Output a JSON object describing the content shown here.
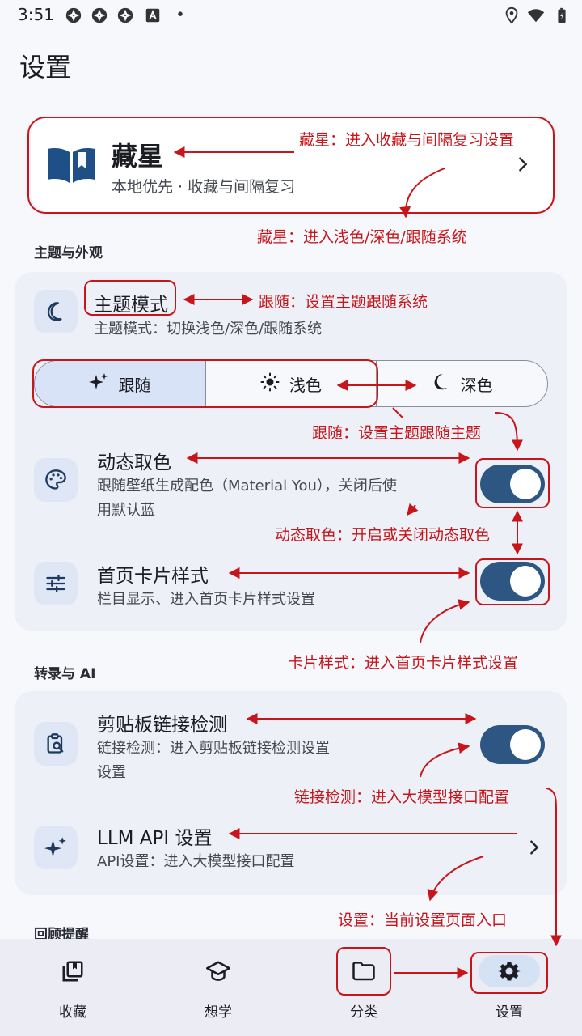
{
  "status_bar": {
    "time": "3:51",
    "icons": [
      "aperture-icon",
      "aperture-icon",
      "aperture-icon",
      "font-a-icon",
      "dot-icon",
      "location-icon",
      "wifi-icon",
      "battery-icon"
    ]
  },
  "page": {
    "title": "设置"
  },
  "main_card": {
    "title": "藏星",
    "subtitle": "本地优先 · 收藏与间隔复习",
    "icon": "book-icon"
  },
  "sections": {
    "theme": {
      "label": "主题与外观",
      "theme_mode": {
        "title": "主题模式",
        "subtitle": "主题模式：切换浅色/深色/跟随系统",
        "icon": "moon-icon"
      },
      "segments": [
        {
          "label": "跟随",
          "icon": "sparkle-icon",
          "active": true
        },
        {
          "label": "浅色",
          "icon": "sun-icon",
          "active": false
        },
        {
          "label": "深色",
          "icon": "moon-icon",
          "active": false
        }
      ],
      "dynamic_color": {
        "title": "动态取色",
        "subtitle_line1": "跟随壁纸生成配色（Material You），关闭后使",
        "subtitle_line2": "用默认蓝",
        "icon": "palette-icon",
        "enabled": true
      },
      "home_card_style": {
        "title": "首页卡片样式",
        "subtitle": "栏目显示、进入首页卡片样式设置",
        "icon": "sliders-icon",
        "enabled": true
      }
    },
    "transcribe": {
      "label": "转录与 AI",
      "clipboard": {
        "title": "剪贴板链接检测",
        "subtitle_line1": "链接检测：进入剪贴板链接检测设置",
        "subtitle_line2": "设置",
        "icon": "clipboard-search-icon",
        "enabled": true
      },
      "llm": {
        "title": "LLM API 设置",
        "subtitle": "API设置：进入大模型接口配置",
        "icon": "sparkle-icon"
      }
    },
    "review": {
      "label": "回顾提醒"
    }
  },
  "bottom_nav": [
    {
      "label": "收藏",
      "icon": "bookmark-collection-icon",
      "active": false
    },
    {
      "label": "想学",
      "icon": "graduation-cap-icon",
      "active": false
    },
    {
      "label": "分类",
      "icon": "folder-icon",
      "active": false
    },
    {
      "label": "设置",
      "icon": "gear-icon",
      "active": true
    }
  ],
  "annotations": {
    "a1": "藏星：进入收藏与间隔复习设置",
    "a2": "藏星：进入浅色/深色/跟随系统",
    "a3": "跟随：设置主题跟随系统",
    "a4": "跟随：设置主题跟随主题",
    "a5": "动态取色：开启或关闭动态取色",
    "a6": "卡片样式：进入首页卡片样式设置",
    "a7": "链接检测：进入大模型接口配置",
    "a8": "设置：当前设置页面入口"
  },
  "colors": {
    "accent": "#2e5683",
    "annotation": "#c7161b",
    "tile": "#dfe6f6",
    "group_bg": "#eef0f7"
  }
}
